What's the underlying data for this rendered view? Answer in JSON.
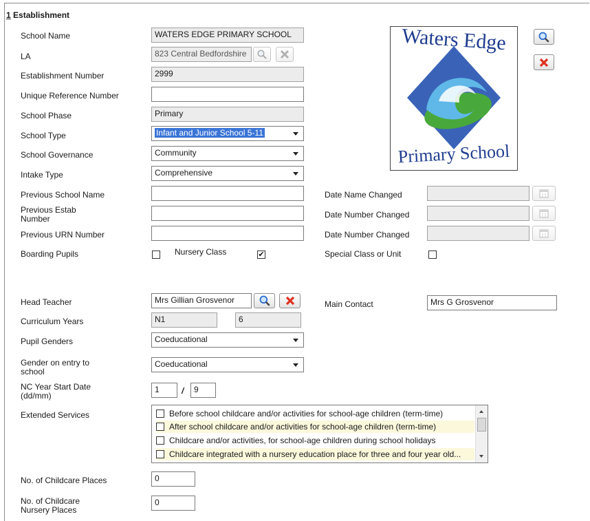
{
  "section": {
    "number": "1",
    "title": "Establishment"
  },
  "fields": {
    "school_name": {
      "label": "School Name",
      "value": "WATERS EDGE PRIMARY SCHOOL"
    },
    "la": {
      "label": "LA",
      "value": "823 Central Bedfordshire"
    },
    "estab_number": {
      "label": "Establishment Number",
      "value": "2999"
    },
    "urn": {
      "label": "Unique Reference Number",
      "value": ""
    },
    "school_phase": {
      "label": "School Phase",
      "value": "Primary"
    },
    "school_type": {
      "label": "School Type",
      "value": "Infant and Junior School 5-11"
    },
    "governance": {
      "label": "School Governance",
      "value": "Community"
    },
    "intake": {
      "label": "Intake Type",
      "value": "Comprehensive"
    },
    "prev_name": {
      "label": "Previous School Name",
      "value": ""
    },
    "prev_estab": {
      "label": "Previous Estab Number",
      "value": ""
    },
    "prev_urn": {
      "label": "Previous URN Number",
      "value": ""
    },
    "boarding": {
      "label": "Boarding Pupils",
      "checked": false
    },
    "nursery": {
      "label": "Nursery Class",
      "checked": true
    },
    "special": {
      "label": "Special Class or Unit",
      "checked": false
    },
    "date_name_changed": {
      "label": "Date Name Changed",
      "value": ""
    },
    "date_number_changed_1": {
      "label": "Date Number Changed",
      "value": ""
    },
    "date_number_changed_2": {
      "label": "Date Number Changed",
      "value": ""
    },
    "head_teacher": {
      "label": "Head Teacher",
      "value": "Mrs Gillian Grosvenor"
    },
    "main_contact": {
      "label": "Main Contact",
      "value": "Mrs G Grosvenor"
    },
    "curriculum_years": {
      "label": "Curriculum Years",
      "from": "N1",
      "to": "6"
    },
    "pupil_genders": {
      "label": "Pupil Genders",
      "value": "Coeducational"
    },
    "gender_entry": {
      "label": "Gender on entry to school",
      "value": "Coeducational"
    },
    "nc_year_start": {
      "label": "NC Year Start Date (dd/mm)",
      "day": "1",
      "sep": "/",
      "month": "9"
    },
    "extended_services": {
      "label": "Extended Services",
      "items": [
        "Before school childcare and/or activities for school-age children (term-time)",
        "After school childcare and/or activities for school-age children (term-time)",
        "Childcare and/or activities, for school-age children during school holidays",
        "Childcare integrated with a nursery education place for three and four year old..."
      ]
    },
    "childcare_places": {
      "label": "No. of Childcare Places",
      "value": "0"
    },
    "nursery_places": {
      "label": "No. of Childcare Nursery Places",
      "value": "0"
    }
  },
  "logo": {
    "top_text": "Waters Edge",
    "bottom_text": "Primary School"
  },
  "icons": {
    "search": "search-icon",
    "clear": "clear-x-icon",
    "calendar": "calendar-icon"
  },
  "colors": {
    "selection": "#3a74d6",
    "logo_text": "#1f3d8f",
    "highlight_row": "#fbf8dc"
  }
}
